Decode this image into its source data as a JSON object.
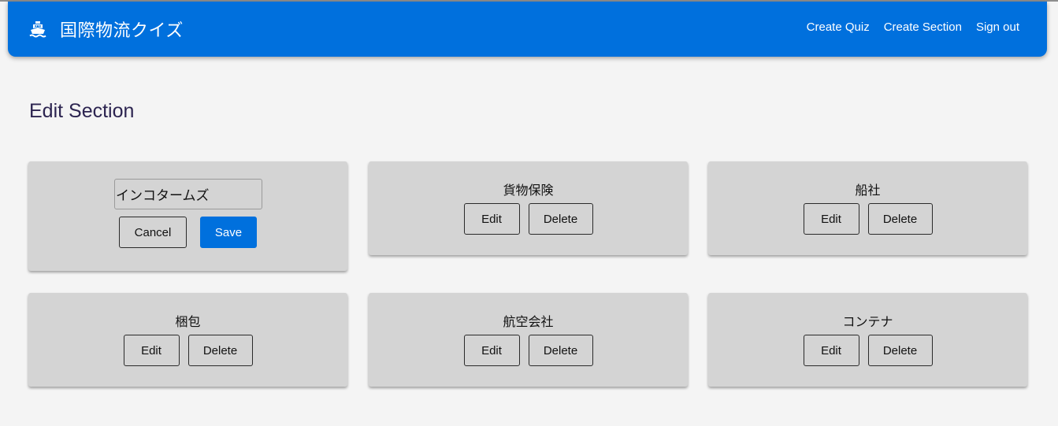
{
  "navbar": {
    "brand_icon": "ship-icon",
    "title": "国際物流クイズ",
    "links": [
      "Create Quiz",
      "Create Section",
      "Sign out"
    ]
  },
  "page": {
    "title": "Edit Section"
  },
  "sections": [
    {
      "name": "インコタームズ",
      "editing": true,
      "input_value": "インコタームズ",
      "cancel_label": "Cancel",
      "save_label": "Save"
    },
    {
      "name": "貨物保険",
      "edit_label": "Edit",
      "delete_label": "Delete"
    },
    {
      "name": "船社",
      "edit_label": "Edit",
      "delete_label": "Delete"
    },
    {
      "name": "梱包",
      "edit_label": "Edit",
      "delete_label": "Delete"
    },
    {
      "name": "航空会社",
      "edit_label": "Edit",
      "delete_label": "Delete"
    },
    {
      "name": "コンテナ",
      "edit_label": "Edit",
      "delete_label": "Delete"
    }
  ],
  "colors": {
    "primary": "#0070dd",
    "card": "#d4d4d4",
    "background": "#f4f4f4",
    "title_text": "#2c2450"
  }
}
